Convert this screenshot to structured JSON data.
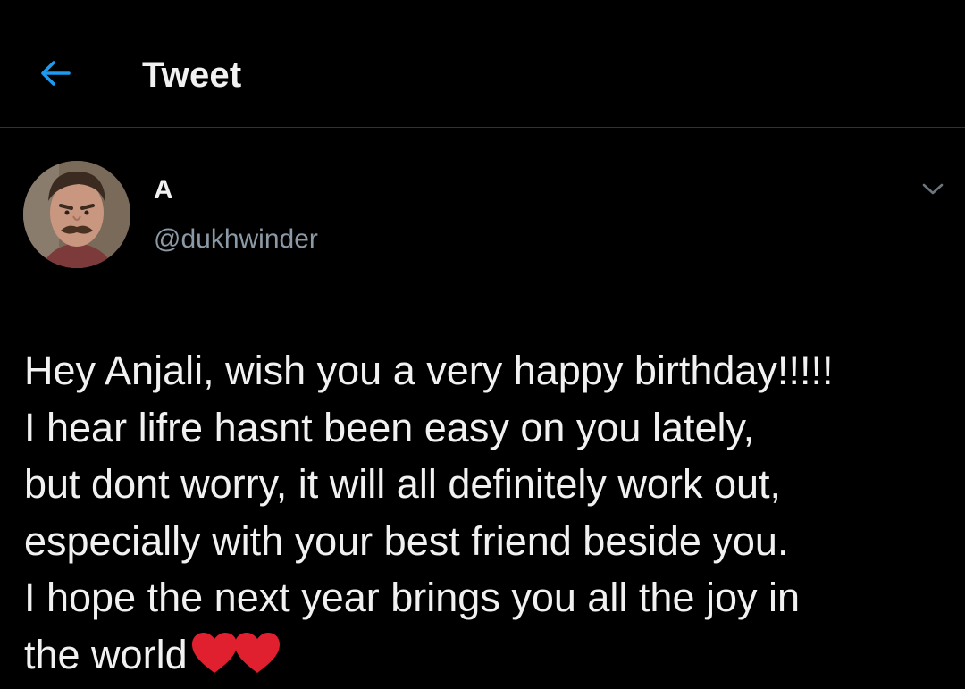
{
  "header": {
    "back_icon": "arrow-left-icon",
    "title": "Tweet",
    "accent_color": "#1d9bf0"
  },
  "author": {
    "display_name": "A",
    "handle": "@dukhwinder",
    "avatar": "profile-photo",
    "more_icon": "chevron-down-icon"
  },
  "tweet": {
    "lines": [
      "Hey Anjali, wish you a very happy birthday!!!!!",
      "I hear lifre hasnt been easy on you lately,",
      "but dont worry, it will all definitely work out,",
      "especially with your best friend beside you.",
      "I hope the next year brings you all the joy in",
      "the world"
    ],
    "emoji": [
      "red-heart",
      "red-heart"
    ],
    "emoji_color": "#e0202e"
  }
}
